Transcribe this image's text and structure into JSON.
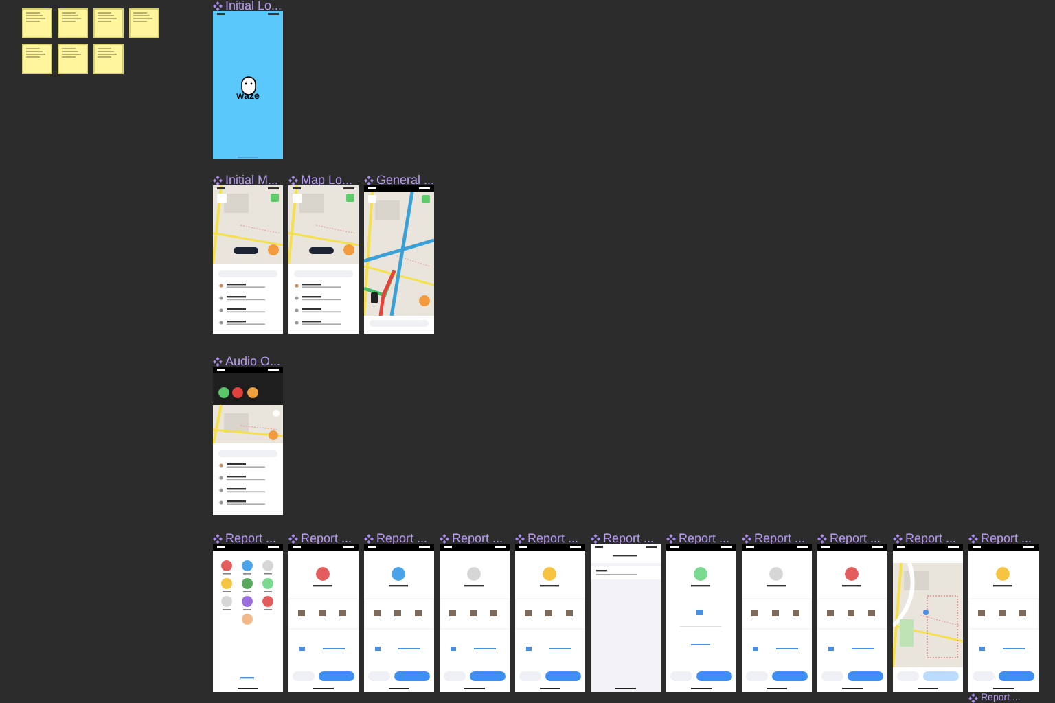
{
  "sticky_notes": [
    {
      "kind": "note"
    },
    {
      "kind": "note"
    },
    {
      "kind": "note"
    },
    {
      "kind": "note"
    },
    {
      "kind": "note"
    },
    {
      "kind": "note"
    },
    {
      "kind": "note"
    }
  ],
  "rows": [
    {
      "frames": [
        {
          "title": "Initial Lo...",
          "kind": "splash",
          "logo_text": "waze"
        }
      ]
    },
    {
      "frames": [
        {
          "title": "Initial M...",
          "kind": "map"
        },
        {
          "title": "Map Lo...",
          "kind": "map"
        },
        {
          "title": "General ...",
          "kind": "navigation"
        }
      ]
    },
    {
      "frames": [
        {
          "title": "Audio O...",
          "kind": "audio"
        }
      ]
    },
    {
      "frames": [
        {
          "title": "Report ...",
          "kind": "report_menu"
        },
        {
          "title": "Report ...",
          "kind": "report_form",
          "color": "#e35d5d"
        },
        {
          "title": "Report ...",
          "kind": "report_form",
          "color": "#4aa3e8"
        },
        {
          "title": "Report ...",
          "kind": "report_form",
          "color": "#d6d6d6"
        },
        {
          "title": "Report ...",
          "kind": "report_form",
          "color": "#f5c542"
        },
        {
          "title": "Report ...",
          "kind": "list"
        },
        {
          "title": "Report ...",
          "kind": "report_chat",
          "color": "#78d98f"
        },
        {
          "title": "Report ...",
          "kind": "report_form",
          "color": "#d6d6d6"
        },
        {
          "title": "Report ...",
          "kind": "report_form",
          "color": "#e35d5d"
        },
        {
          "title": "Report ...",
          "kind": "report_map"
        },
        {
          "title": "Report ...",
          "kind": "report_form",
          "color": "#f5c542"
        }
      ]
    },
    {
      "frames": [
        {
          "title": "Report ...",
          "kind": "title_only"
        }
      ]
    }
  ]
}
